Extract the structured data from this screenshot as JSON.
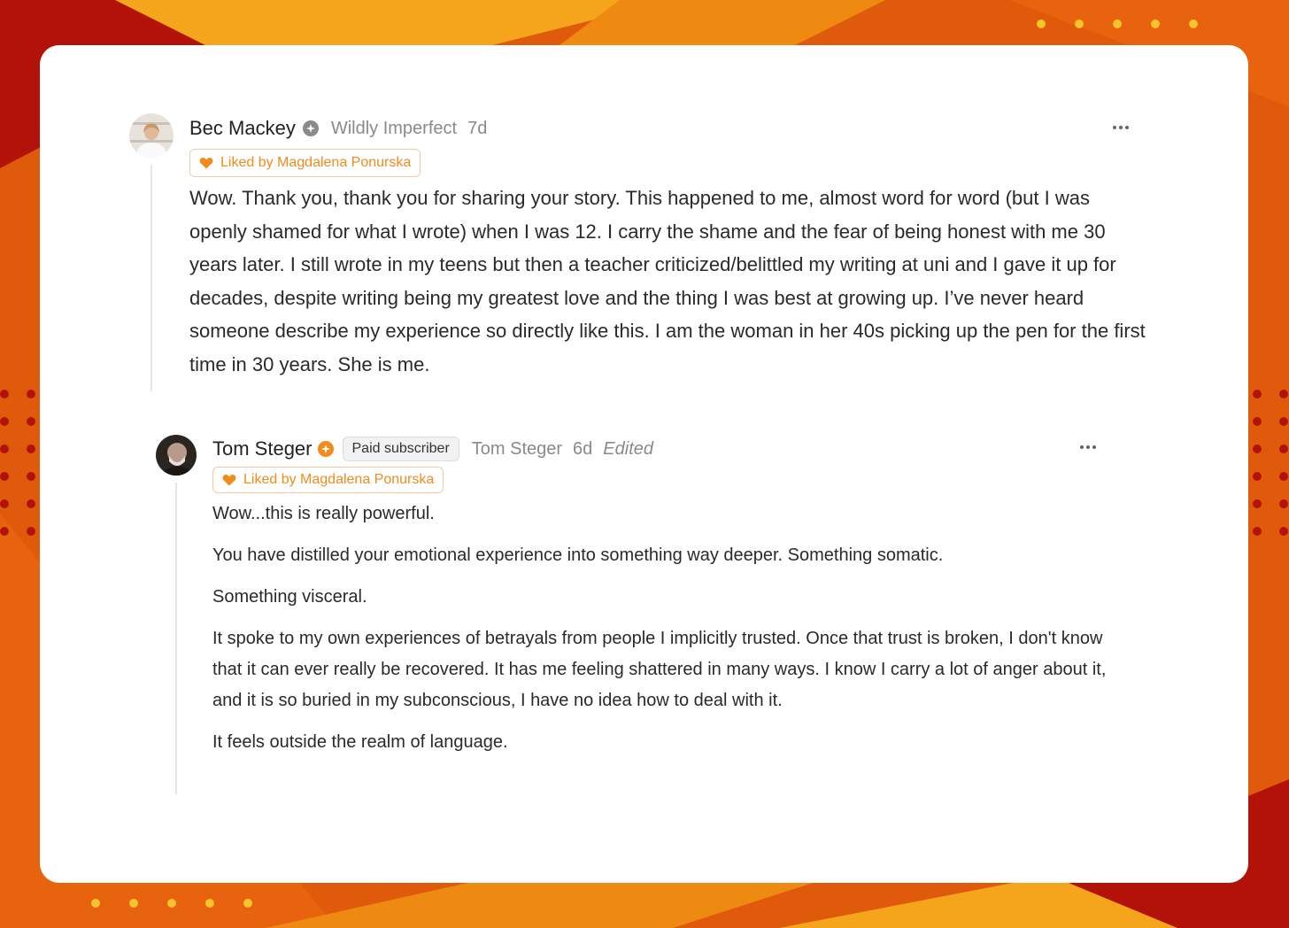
{
  "comments": [
    {
      "author": "Bec Mackey",
      "publication": "Wildly Imperfect",
      "age": "7d",
      "liked_by": "Liked by Magdalena Ponurska",
      "body": "Wow. Thank you, thank you for sharing your story. This happened to me, almost word for word (but I was openly shamed for what I wrote) when I was 12. I carry the shame and the fear of being honest with me 30 years later. I still wrote in my teens but then a teacher criticized/belittled my writing at uni and I gave it up for decades, despite writing being my greatest love and the thing I was best at growing up. I’ve never heard someone describe my experience so directly like this. I am the woman in her 40s picking up the pen for the first time in 30 years. She is me."
    },
    {
      "author": "Tom Steger",
      "badge": "Paid subscriber",
      "publication": "Tom Steger",
      "age": "6d",
      "edited": "Edited",
      "liked_by": "Liked by Magdalena Ponurska",
      "paragraphs": [
        "Wow...this is really powerful.",
        "You have distilled your emotional experience into something way deeper. Something somatic.",
        "Something visceral.",
        "It spoke to my own experiences of betrayals from people I implicitly trusted. Once that trust is broken, I don't know that it can ever really be recovered. It has me feeling shattered in many ways. I know I carry a lot of anger about it, and it is so buried in my subconscious, I have no idea how to deal with it.",
        "It feels outside the realm of language."
      ]
    }
  ],
  "colors": {
    "accent": "#f08b1c",
    "background_orange": "#e05a0c",
    "background_red": "#b31208",
    "background_yellow": "#f4a51c",
    "dots_yellow": "#f5c52a"
  },
  "icons": [
    "heart-icon",
    "more-options-icon",
    "publication-badge-icon"
  ]
}
